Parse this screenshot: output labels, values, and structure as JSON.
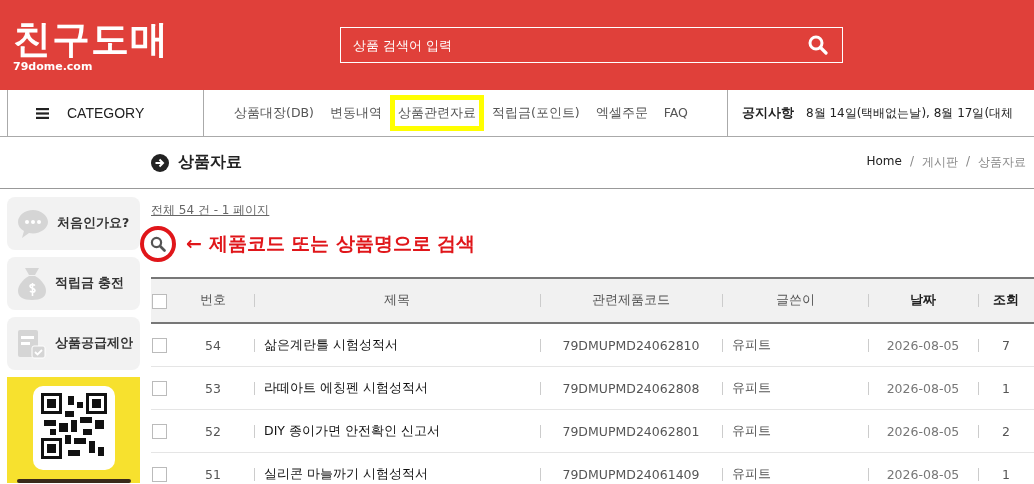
{
  "header": {
    "logo": "친구도매",
    "logo_domain": "79dome.com",
    "search": {
      "placeholder": "상품 검색어 입력"
    }
  },
  "nav": {
    "category": "CATEGORY",
    "items": [
      {
        "label": "상품대장(DB)",
        "selected": false
      },
      {
        "label": "변동내역",
        "selected": false
      },
      {
        "label": "상품관련자료",
        "selected": true
      },
      {
        "label": "적립금(포인트)",
        "selected": false
      },
      {
        "label": "엑셀주문",
        "selected": false
      },
      {
        "label": "FAQ",
        "selected": false
      }
    ],
    "notice_label": "공지사항",
    "notice_text": "8월 14일(택배없는날), 8월 17일(대체"
  },
  "page": {
    "title": "상품자료",
    "breadcrumb": [
      "Home",
      "게시판",
      "상품자료"
    ],
    "breadcrumb_separator": "/"
  },
  "sidebar": {
    "items": [
      {
        "kind": "chat",
        "label": "처음인가요?"
      },
      {
        "kind": "money",
        "label": "적립금 충전"
      },
      {
        "kind": "form",
        "label": "상품공급제안"
      }
    ]
  },
  "board": {
    "summary": "전체 54 건 - 1 페이지",
    "annotation": "← 제품코드 또는 상품명으로 검색"
  },
  "table": {
    "select_all_checked": false,
    "columns": [
      "번호",
      "제목",
      "관련제품코드",
      "글쓴이",
      "날짜",
      "조회"
    ],
    "rows": [
      {
        "checked": false,
        "cells": [
          "54",
          "삶은계란틀 시험성적서",
          "79DMUPMD24062810",
          "유피트",
          "2026-08-05",
          "7"
        ]
      },
      {
        "checked": false,
        "cells": [
          "53",
          "라떼아트 에칭펜 시험성적서",
          "79DMUPMD24062808",
          "유피트",
          "2026-08-05",
          "1"
        ]
      },
      {
        "checked": false,
        "cells": [
          "52",
          "DIY 종이가면 안전확인 신고서",
          "79DMUPMD24062801",
          "유피트",
          "2026-08-05",
          "2"
        ]
      },
      {
        "checked": false,
        "cells": [
          "51",
          "실리콘 마늘까기 시험성적서",
          "79DMUPMD24061409",
          "유피트",
          "2026-08-05",
          "1"
        ]
      }
    ]
  }
}
